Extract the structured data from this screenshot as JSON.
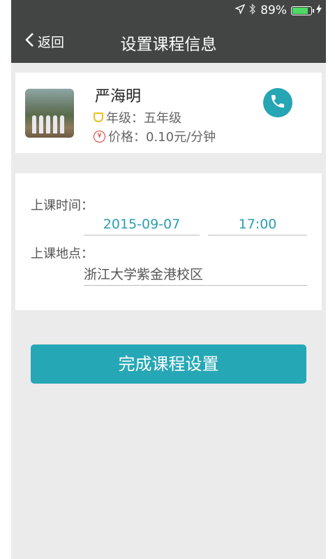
{
  "status_bar": {
    "battery_text": "89%",
    "battery_level": 0.89
  },
  "navbar": {
    "back_label": "返回",
    "title": "设置课程信息"
  },
  "teacher": {
    "name": "严海明",
    "grade": "年级：五年级",
    "price": "价格：0.10元/分钟"
  },
  "form": {
    "time_label": "上课时间：",
    "date_value": "2015-09-07",
    "time_value": "17:00",
    "place_label": "上课地点：",
    "place_value": "浙江大学紫金港校区"
  },
  "submit_label": "完成课程设置",
  "colors": {
    "accent": "#26a7b5",
    "header": "#434545",
    "background": "#ebebeb"
  }
}
